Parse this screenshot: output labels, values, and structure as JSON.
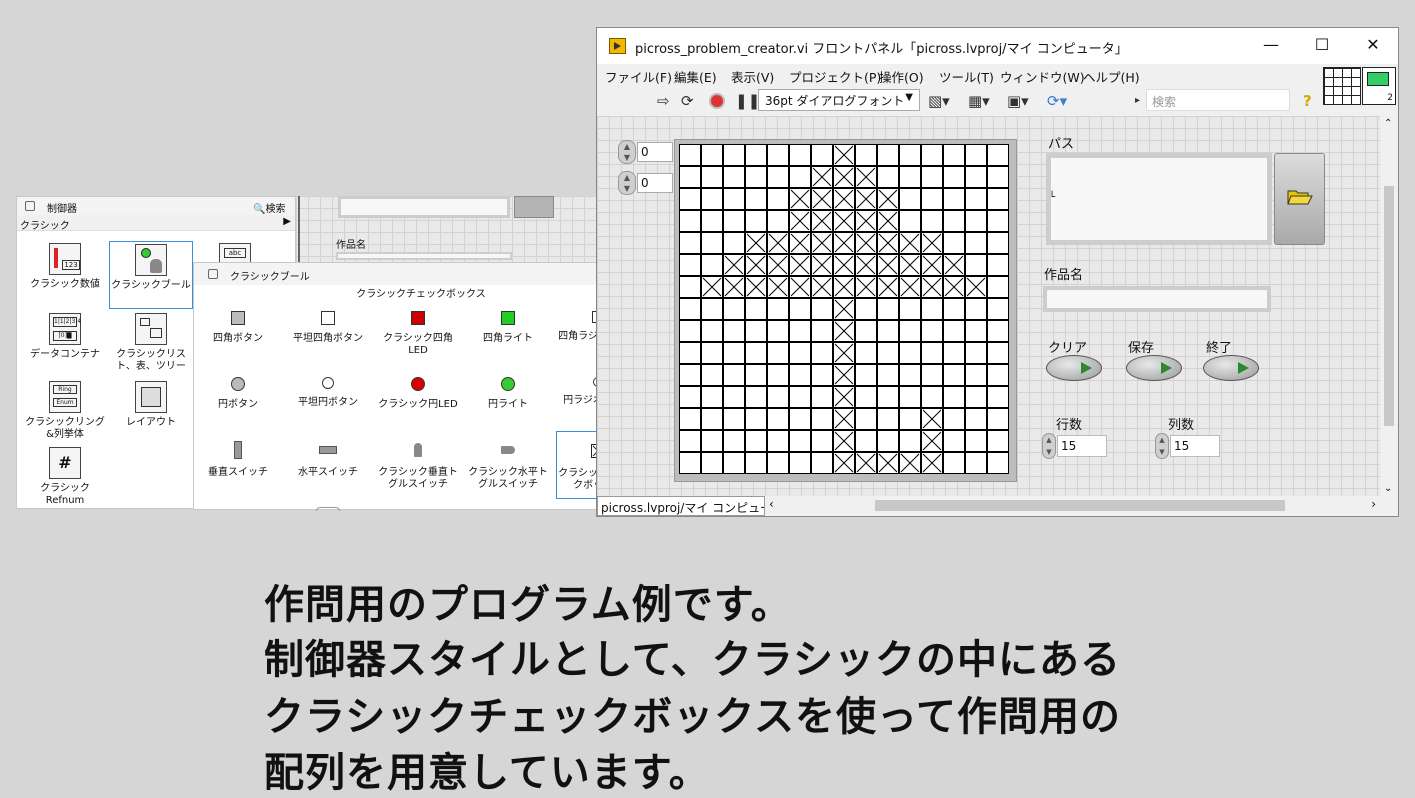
{
  "window": {
    "title": "picross_problem_creator.vi フロントパネル「picross.lvproj/マイ コンピュータ」",
    "minimize": "—",
    "maximize": "☐",
    "close": "✕"
  },
  "menu": [
    "ファイル(F)",
    "編集(E)",
    "表示(V)",
    "プロジェクト(P)",
    "操作(O)",
    "ツール(T)",
    "ウィンドウ(W)",
    "ヘルプ(H)"
  ],
  "toolbar": {
    "font": "36pt ダイアログフォント",
    "search_placeholder": "検索",
    "help": "?",
    "vi_icon_number": "2"
  },
  "front_panel": {
    "row_index": "0",
    "col_index": "0",
    "path_label": "パス",
    "title_label": "作品名",
    "clear_label": "クリア",
    "save_label": "保存",
    "exit_label": "終了",
    "rows_label": "行数",
    "cols_label": "列数",
    "rows_value": "15",
    "cols_value": "15"
  },
  "grid": {
    "rows": 15,
    "cols": 15,
    "checked": [
      [
        0,
        7
      ],
      [
        1,
        6
      ],
      [
        1,
        7
      ],
      [
        1,
        8
      ],
      [
        2,
        5
      ],
      [
        2,
        6
      ],
      [
        2,
        7
      ],
      [
        2,
        8
      ],
      [
        2,
        9
      ],
      [
        3,
        5
      ],
      [
        3,
        6
      ],
      [
        3,
        7
      ],
      [
        3,
        8
      ],
      [
        3,
        9
      ],
      [
        4,
        3
      ],
      [
        4,
        4
      ],
      [
        4,
        5
      ],
      [
        4,
        6
      ],
      [
        4,
        7
      ],
      [
        4,
        8
      ],
      [
        4,
        9
      ],
      [
        4,
        10
      ],
      [
        4,
        11
      ],
      [
        5,
        2
      ],
      [
        5,
        3
      ],
      [
        5,
        4
      ],
      [
        5,
        5
      ],
      [
        5,
        6
      ],
      [
        5,
        7
      ],
      [
        5,
        8
      ],
      [
        5,
        9
      ],
      [
        5,
        10
      ],
      [
        5,
        11
      ],
      [
        5,
        12
      ],
      [
        6,
        1
      ],
      [
        6,
        2
      ],
      [
        6,
        3
      ],
      [
        6,
        4
      ],
      [
        6,
        5
      ],
      [
        6,
        6
      ],
      [
        6,
        7
      ],
      [
        6,
        8
      ],
      [
        6,
        9
      ],
      [
        6,
        10
      ],
      [
        6,
        11
      ],
      [
        6,
        12
      ],
      [
        6,
        13
      ],
      [
        7,
        7
      ],
      [
        8,
        7
      ],
      [
        9,
        7
      ],
      [
        10,
        7
      ],
      [
        11,
        7
      ],
      [
        12,
        7
      ],
      [
        12,
        11
      ],
      [
        13,
        7
      ],
      [
        13,
        11
      ],
      [
        14,
        7
      ],
      [
        14,
        8
      ],
      [
        14,
        9
      ],
      [
        14,
        10
      ],
      [
        14,
        11
      ]
    ]
  },
  "status_bar": "picross.lvproj/マイ コンピュータ",
  "palette": {
    "title": "制御器",
    "search": "検索",
    "category": "クラシック",
    "items": [
      "クラシック数値",
      "クラシックブール",
      "データコンテナ",
      "クラシックリスト、表、ツリー",
      "クラシックリング&列挙体",
      "レイアウト",
      "クラシックRefnum"
    ]
  },
  "palette2": {
    "title": "クラシックブール",
    "hover": "クラシックチェックボックス",
    "items": [
      "四角ボタン",
      "平坦四角ボタン",
      "クラシック四角LED",
      "四角ライト",
      "四角ラジオボタン",
      "円ボタン",
      "平坦円ボタン",
      "クラシック円LED",
      "円ライト",
      "円ラジオボタン",
      "垂直スイッチ",
      "水平スイッチ",
      "クラシック垂直トグルスイッチ",
      "クラシック水平トグルスイッチ",
      "クラシックチェックボックス"
    ]
  },
  "behind": {
    "label": "作品名"
  },
  "caption": [
    "作問用のプログラム例です。",
    "制御器スタイルとして、クラシックの中にある",
    "クラシックチェックボックスを使って作問用の",
    "配列を用意しています。"
  ]
}
